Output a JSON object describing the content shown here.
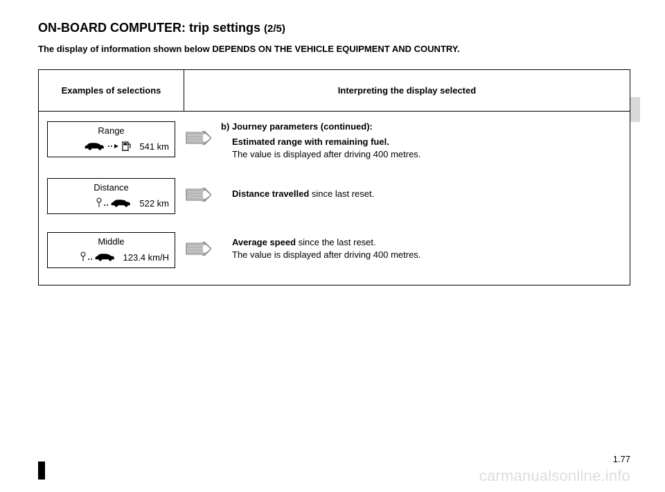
{
  "header": {
    "title_main": "ON-BOARD COMPUTER: trip settings",
    "title_sub": "(2/5)",
    "depends_note": "The display of information shown below DEPENDS ON THE VEHICLE EQUIPMENT AND COUNTRY."
  },
  "table": {
    "col1_header": "Examples of selections",
    "col2_header": "Interpreting the display selected",
    "rows": [
      {
        "selection_label": "Range",
        "selection_value": "541 km",
        "icon": "fuel",
        "heading": "b) Journey parameters (continued):",
        "desc_bold": "Estimated range with remaining fuel.",
        "desc_rest": "The value is displayed after driving 400 metres."
      },
      {
        "selection_label": "Distance",
        "selection_value": "522 km",
        "icon": "pin-car",
        "heading": "",
        "desc_bold": "Distance travelled",
        "desc_rest": " since last reset."
      },
      {
        "selection_label": "Middle",
        "selection_value": "123.4 km/H",
        "icon": "pin-car",
        "heading": "",
        "desc_bold": "Average speed",
        "desc_rest": " since the last reset.",
        "desc_line2": "The value is displayed after driving 400 metres."
      }
    ]
  },
  "footer": {
    "page_number": "1.77",
    "watermark": "carmanualsonline.info"
  }
}
